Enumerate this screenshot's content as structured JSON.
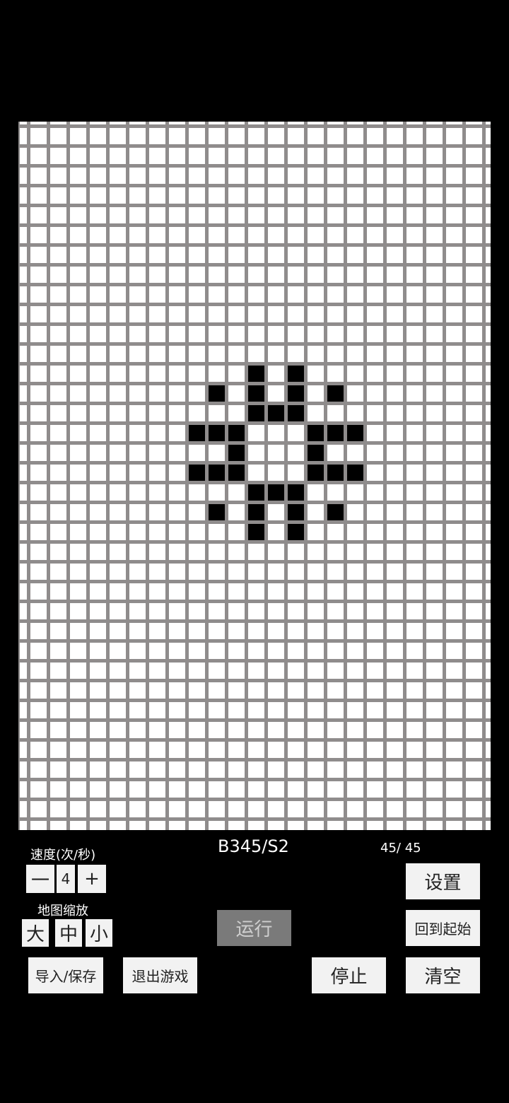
{
  "rule": "B345/S2",
  "counter": "45/ 45",
  "speed": {
    "label": "速度(次/秒)",
    "minus": "一",
    "value": "4",
    "plus": "+"
  },
  "zoom": {
    "label": "地图缩放",
    "large": "大",
    "medium": "中",
    "small": "小"
  },
  "buttons": {
    "settings": "设置",
    "run": "运行",
    "reset": "回到起始",
    "import_save": "导入/保存",
    "exit": "退出游戏",
    "stop": "停止",
    "clear": "清空"
  },
  "grid": {
    "cols": 24,
    "rows": 36,
    "line_color": "#8f8c8c",
    "alive_color": "#000000",
    "dead_color": "#ffffff",
    "alive_cells": [
      [
        11,
        12
      ],
      [
        13,
        12
      ],
      [
        9,
        13
      ],
      [
        11,
        13
      ],
      [
        13,
        13
      ],
      [
        15,
        13
      ],
      [
        11,
        14
      ],
      [
        12,
        14
      ],
      [
        13,
        14
      ],
      [
        8,
        15
      ],
      [
        9,
        15
      ],
      [
        10,
        15
      ],
      [
        14,
        15
      ],
      [
        15,
        15
      ],
      [
        16,
        15
      ],
      [
        10,
        16
      ],
      [
        14,
        16
      ],
      [
        8,
        17
      ],
      [
        9,
        17
      ],
      [
        10,
        17
      ],
      [
        14,
        17
      ],
      [
        15,
        17
      ],
      [
        16,
        17
      ],
      [
        11,
        18
      ],
      [
        12,
        18
      ],
      [
        13,
        18
      ],
      [
        9,
        19
      ],
      [
        11,
        19
      ],
      [
        13,
        19
      ],
      [
        15,
        19
      ],
      [
        11,
        20
      ],
      [
        13,
        20
      ]
    ]
  }
}
